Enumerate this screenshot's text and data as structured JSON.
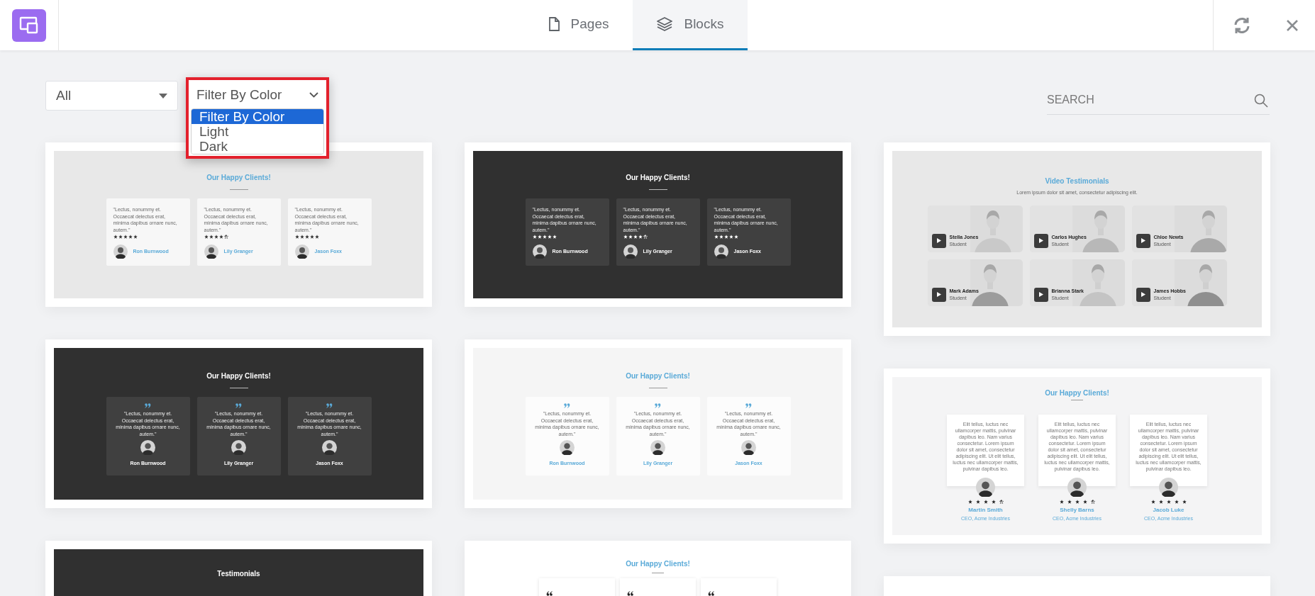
{
  "header": {
    "tabs": [
      {
        "label": "Pages",
        "selected": false
      },
      {
        "label": "Blocks",
        "selected": true
      }
    ]
  },
  "filters": {
    "category": {
      "value": "All"
    },
    "color": {
      "value": "Filter By Color",
      "expanded": true,
      "options": [
        {
          "label": "Filter By Color",
          "selected": true
        },
        {
          "label": "Light",
          "selected": false
        },
        {
          "label": "Dark",
          "selected": false
        }
      ]
    }
  },
  "search": {
    "placeholder": "SEARCH"
  },
  "columns": [
    {
      "blocks": [
        {
          "kind": "stars",
          "dark": false,
          "title": "Our Happy Clients!",
          "cards": [
            {
              "quote": "\"Lectus, nonummy et. Occaecat delectus erat, minima dapibus ornare nunc, autem.\"",
              "stars": 5,
              "name": "Ron Burnwood"
            },
            {
              "quote": "\"Lectus, nonummy et. Occaecat delectus erat, minima dapibus ornare nunc, autem.\"",
              "stars": 4.5,
              "name": "Lily Granger"
            },
            {
              "quote": "\"Lectus, nonummy et. Occaecat delectus erat, minima dapibus ornare nunc, autem.\"",
              "stars": 5,
              "name": "Jason Foxx"
            }
          ]
        },
        {
          "kind": "quotes",
          "dark": true,
          "title": "Our Happy Clients!",
          "cards": [
            {
              "quote": "\"Lectus, nonummy et. Occaecat delectus erat, minima dapibus ornare nunc, autem.\"",
              "name": "Ron Burnwood"
            },
            {
              "quote": "\"Lectus, nonummy et. Occaecat delectus erat, minima dapibus ornare nunc, autem.\"",
              "name": "Lily Granger"
            },
            {
              "quote": "\"Lectus, nonummy et. Occaecat delectus erat, minima dapibus ornare nunc, autem.\"",
              "name": "Jason Foxx"
            }
          ]
        },
        {
          "kind": "heading",
          "dark": true,
          "title": "Testimonials"
        }
      ]
    },
    {
      "blocks": [
        {
          "kind": "stars",
          "dark": true,
          "title": "Our Happy Clients!",
          "cards": [
            {
              "quote": "\"Lectus, nonummy et. Occaecat delectus erat, minima dapibus ornare nunc, autem.\"",
              "stars": 5,
              "name": "Ron Burnwood"
            },
            {
              "quote": "\"Lectus, nonummy et. Occaecat delectus erat, minima dapibus ornare nunc, autem.\"",
              "stars": 4.5,
              "name": "Lily Granger"
            },
            {
              "quote": "\"Lectus, nonummy et. Occaecat delectus erat, minima dapibus ornare nunc, autem.\"",
              "stars": 5,
              "name": "Jason Foxx"
            }
          ]
        },
        {
          "kind": "quotes",
          "dark": false,
          "title": "Our Happy Clients!",
          "cards": [
            {
              "quote": "\"Lectus, nonummy et. Occaecat delectus erat, minima dapibus ornare nunc, autem.\"",
              "name": "Ron Burnwood"
            },
            {
              "quote": "\"Lectus, nonummy et. Occaecat delectus erat, minima dapibus ornare nunc, autem.\"",
              "name": "Lily Granger"
            },
            {
              "quote": "\"Lectus, nonummy et. Occaecat delectus erat, minima dapibus ornare nunc, autem.\"",
              "name": "Jason Foxx"
            }
          ]
        },
        {
          "kind": "quote_marks",
          "dark": false,
          "title": "Our Happy Clients!"
        }
      ]
    },
    {
      "blocks": [
        {
          "kind": "video",
          "dark": false,
          "title": "Video Testimonials",
          "subtitle": "Lorem ipsum dolor sit amet, consectetur adipiscing elit.",
          "tiles": [
            {
              "name": "Stella Jones",
              "role": "Student"
            },
            {
              "name": "Carlos Hughes",
              "role": "Student"
            },
            {
              "name": "Chloe Newts",
              "role": "Student"
            },
            {
              "name": "Mark Adams",
              "role": "Student"
            },
            {
              "name": "Brianna Stark",
              "role": "Student"
            },
            {
              "name": "James Hobbs",
              "role": "Student"
            }
          ]
        },
        {
          "kind": "avatar_below",
          "dark": false,
          "title": "Our Happy Clients!",
          "cards": [
            {
              "quote": "Elit tellus, luctus nec ullamcorper mattis, pulvinar dapibus leo. Nam varius consectetur. Lorem ipsum dolor sit amet, consectetur adipiscing elit. Ut elit tellus, luctus nec ullamcorper mattis, pulvinar dapibus leo.",
              "stars": 4.5,
              "name": "Martin Smith",
              "role": "CEO, Acme Industries"
            },
            {
              "quote": "Elit tellus, luctus nec ullamcorper mattis, pulvinar dapibus leo. Nam varius consectetur. Lorem ipsum dolor sit amet, consectetur adipiscing elit. Ut elit tellus, luctus nec ullamcorper mattis, pulvinar dapibus leo.",
              "stars": 4.5,
              "name": "Shelly Barns",
              "role": "CEO, Acme Industries"
            },
            {
              "quote": "Elit tellus, luctus nec ullamcorper mattis, pulvinar dapibus leo. Nam varius consectetur. Lorem ipsum dolor sit amet, consectetur adipiscing elit. Ut elit tellus, luctus nec ullamcorper mattis, pulvinar dapibus leo.",
              "stars": 5,
              "name": "Jacob Luke",
              "role": "CEO, Acme Industries"
            }
          ]
        },
        {
          "kind": "blank",
          "dark": false
        }
      ]
    }
  ]
}
